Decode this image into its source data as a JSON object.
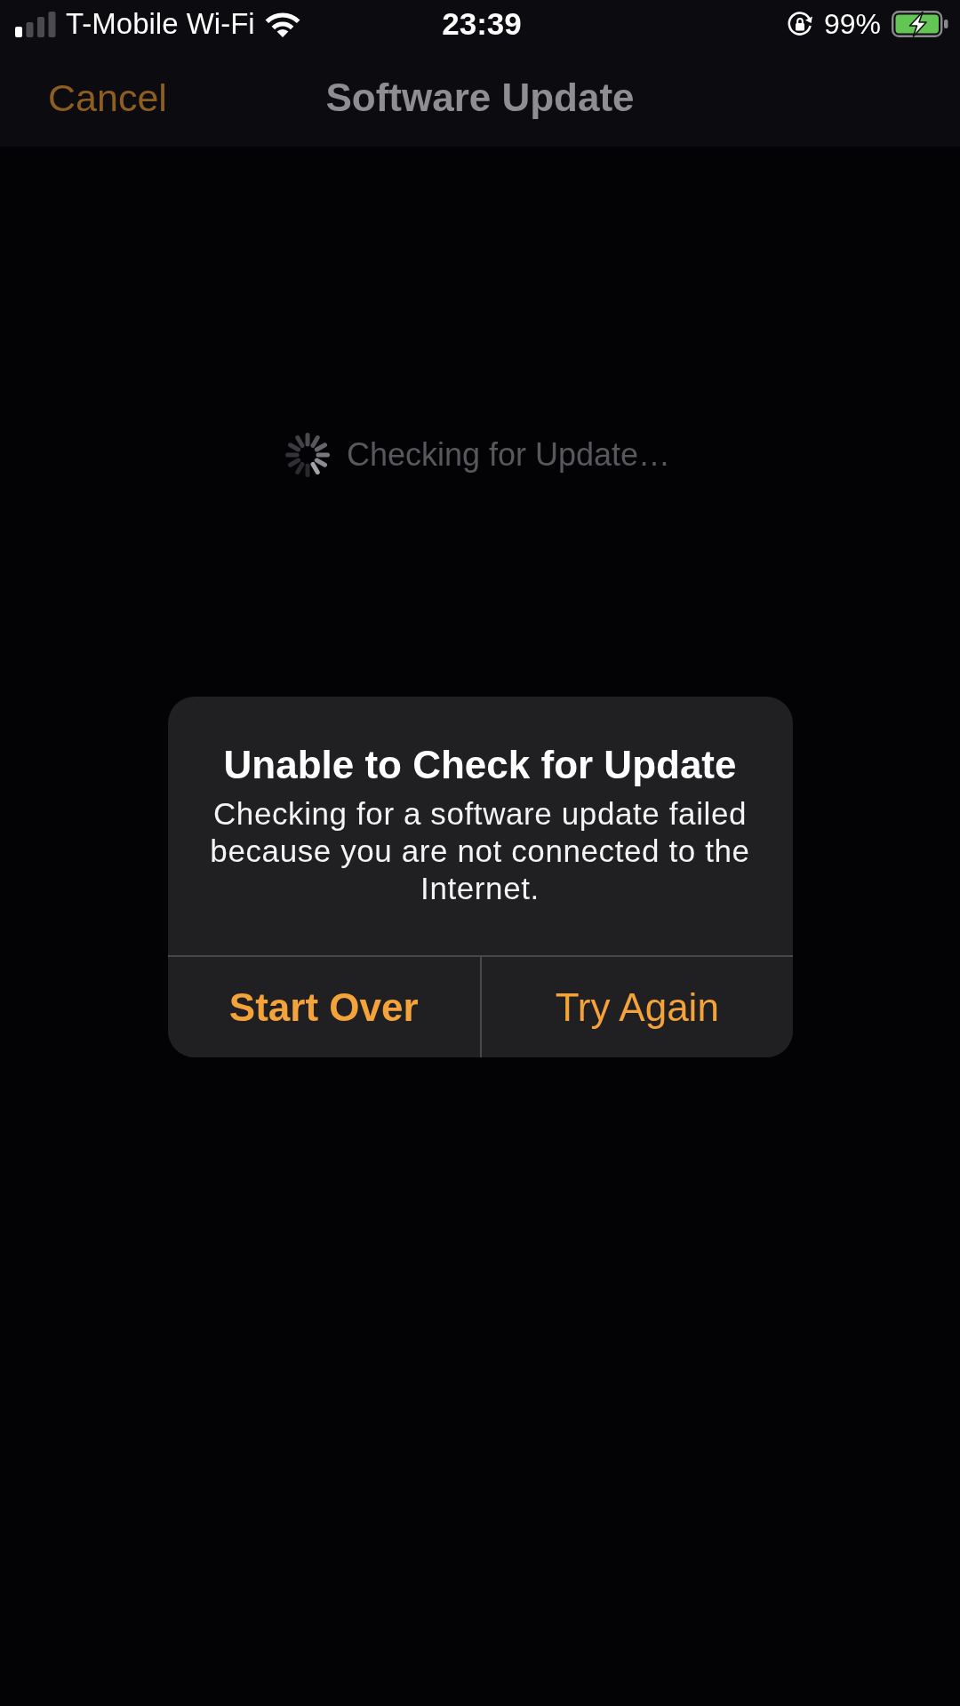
{
  "status_bar": {
    "carrier": "T-Mobile Wi-Fi",
    "time": "23:39",
    "battery": "99%"
  },
  "navigation_bar": {
    "left_button": "Cancel",
    "title": "Software Update"
  },
  "progress": {
    "label": "Checking for Update…"
  },
  "alert": {
    "title": "Unable to Check for Update",
    "message": "Checking for a software update failed because you are not connected to the Internet.",
    "buttons": [
      {
        "label": "Start Over",
        "kind": "preferred"
      },
      {
        "label": "Try Again",
        "kind": "default"
      }
    ]
  }
}
